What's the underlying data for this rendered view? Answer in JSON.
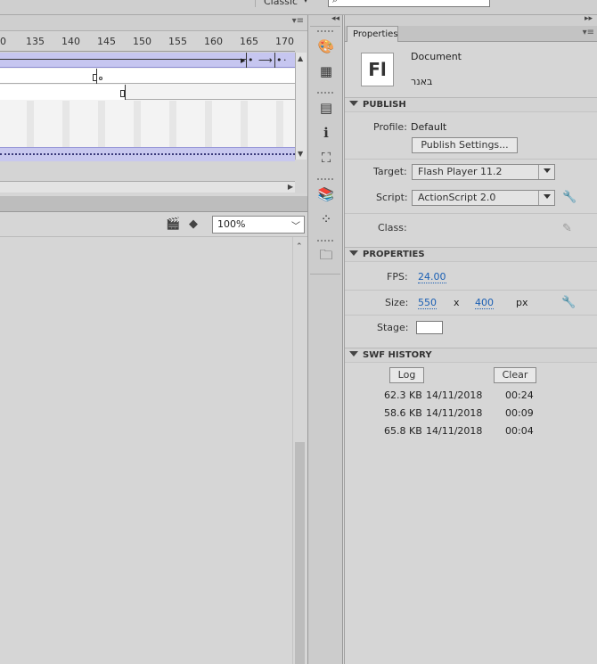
{
  "top_strip": {
    "workspace_label": "Classic",
    "workspace_arrow": "▾",
    "search_glyph": "⌕"
  },
  "timeline": {
    "menu_glyph": "▾≡",
    "ruler_ticks": [
      "0",
      "135",
      "140",
      "145",
      "150",
      "155",
      "160",
      "165",
      "170"
    ]
  },
  "edit_bar": {
    "zoom": "100%"
  },
  "properties": {
    "tab_label": "Properties",
    "doc_icon_text": "Fl",
    "doc_type": "Document",
    "doc_name": "באנר",
    "publish": {
      "section_title": "PUBLISH",
      "profile_label": "Profile:",
      "profile_value": "Default",
      "settings_button": "Publish Settings...",
      "target_label": "Target:",
      "target_value": "Flash Player 11.2",
      "script_label": "Script:",
      "script_value": "ActionScript 2.0",
      "class_label": "Class:"
    },
    "props": {
      "section_title": "PROPERTIES",
      "fps_label": "FPS:",
      "fps_value": "24.00",
      "size_label": "Size:",
      "width": "550",
      "x_sep": "x",
      "height": "400",
      "unit": "px",
      "stage_label": "Stage:",
      "stage_color": "#ffffff"
    },
    "swf_history": {
      "section_title": "SWF HISTORY",
      "log_button": "Log",
      "clear_button": "Clear",
      "entries": [
        {
          "size": "62.3 KB",
          "date": "14/11/2018",
          "time": "00:24"
        },
        {
          "size": "58.6 KB",
          "date": "14/11/2018",
          "time": "00:09"
        },
        {
          "size": "65.8 KB",
          "date": "14/11/2018",
          "time": "00:04"
        }
      ]
    }
  },
  "colors": {
    "panel_bg": "#d6d6d6",
    "link_blue": "#1a5fb4",
    "layer_purple": "#c6c6f0"
  }
}
